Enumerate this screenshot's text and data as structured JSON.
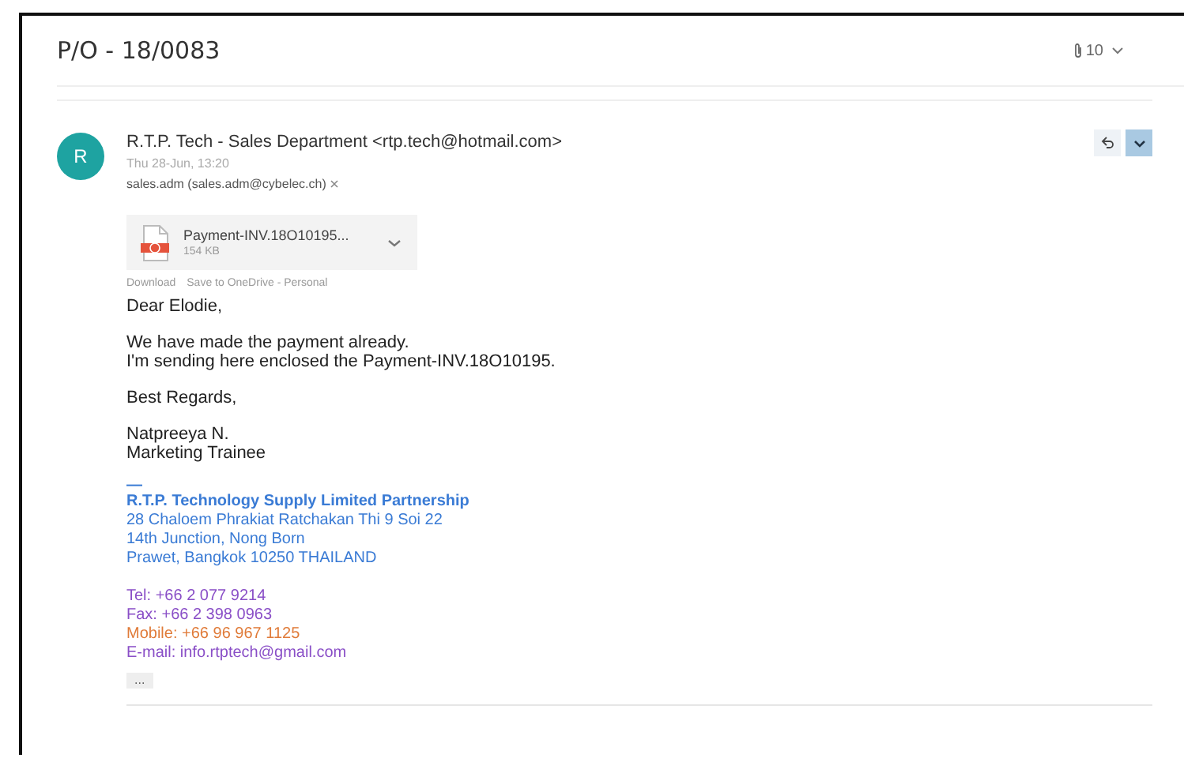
{
  "subject": "P/O - 18/0083",
  "attachment_count": "10",
  "message": {
    "avatar_letter": "R",
    "sender": "R.T.P. Tech - Sales Department <rtp.tech@hotmail.com>",
    "date": "Thu 28-Jun, 13:20",
    "recipients": "sales.adm (sales.adm@cybelec.ch)",
    "attachment": {
      "name": "Payment-INV.18O10195...",
      "size": "154 KB"
    },
    "attachment_links": [
      "Download",
      "Save to OneDrive - Personal"
    ],
    "body": [
      [
        "Dear Elodie,"
      ],
      [
        "We have made the payment already.",
        "I'm sending here enclosed the Payment-INV.18O10195."
      ],
      [
        "Best Regards,"
      ],
      [
        "Natpreeya N.",
        "Marketing Trainee"
      ]
    ],
    "signature": {
      "dash": "—",
      "company": "R.T.P. Technology Supply Limited Partnership",
      "address": [
        "28 Chaloem Phrakiat Ratchakan Thi 9 Soi 22",
        "14th Junction, Nong Born",
        "Prawet, Bangkok 10250 THAILAND"
      ],
      "contacts": [
        {
          "text": "Tel: +66 2 077 9214",
          "color": "#8a4fc7"
        },
        {
          "text": "Fax: +66 2 398 0963",
          "color": "#8a4fc7"
        },
        {
          "text": "Mobile: +66 96 967 1125",
          "color": "#e07b39"
        },
        {
          "text": "E-mail: info.rtptech@gmail.com",
          "color": "#8a4fc7"
        }
      ]
    },
    "more": "..."
  }
}
